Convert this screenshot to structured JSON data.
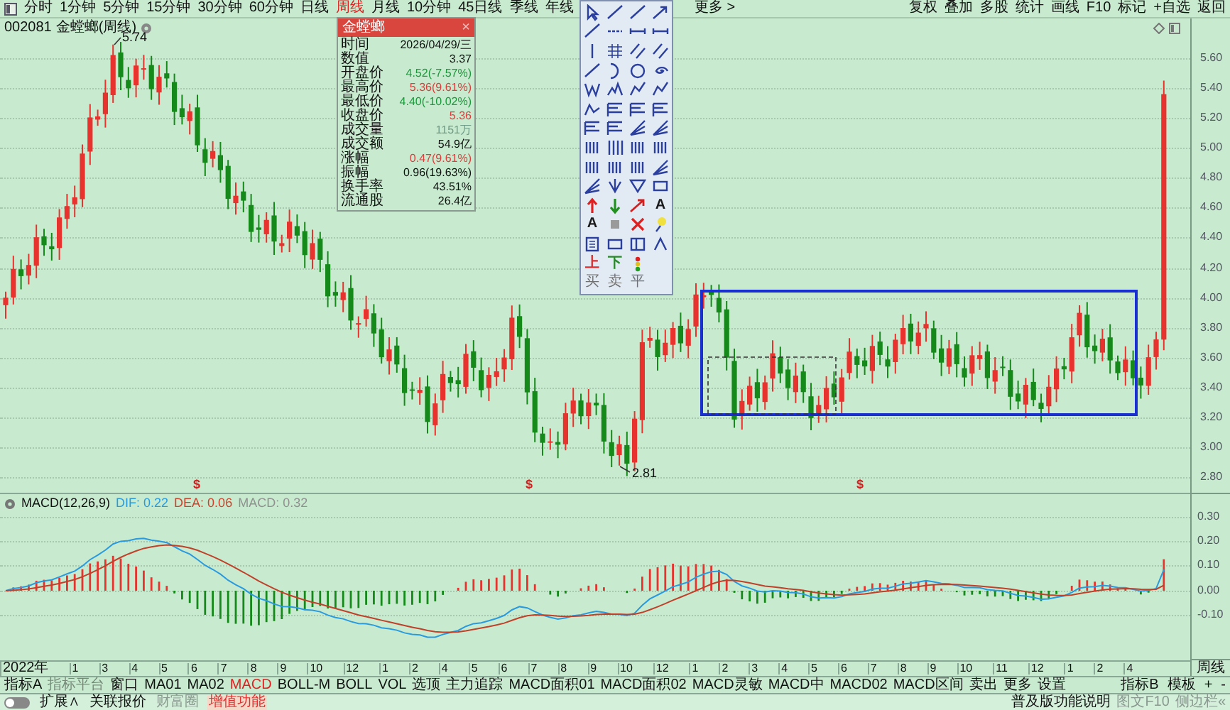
{
  "period_tabs": [
    {
      "label": "分时",
      "selected": false
    },
    {
      "label": "1分钟",
      "selected": false
    },
    {
      "label": "5分钟",
      "selected": false
    },
    {
      "label": "15分钟",
      "selected": false
    },
    {
      "label": "30分钟",
      "selected": false
    },
    {
      "label": "60分钟",
      "selected": false
    },
    {
      "label": "日线",
      "selected": false
    },
    {
      "label": "周线",
      "selected": true
    },
    {
      "label": "月线",
      "selected": false
    },
    {
      "label": "10分钟",
      "selected": false
    },
    {
      "label": "45日线",
      "selected": false
    },
    {
      "label": "季线",
      "selected": false
    },
    {
      "label": "年线",
      "selected": false
    }
  ],
  "more_button": "更多 >",
  "top_actions": [
    "复权",
    "叠加",
    "多股",
    "统计",
    "画线",
    "F10",
    "标记",
    "+自选",
    "返回"
  ],
  "chart_header": {
    "code": "002081",
    "name": "金螳螂(周线)"
  },
  "high_label": "5.74",
  "low_label": "2.81",
  "signal_marks": [
    "$",
    "$",
    "$"
  ],
  "info_panel": {
    "title": "金螳螂",
    "close": "×",
    "rows": [
      {
        "label": "时间",
        "value": "2026/04/29/三",
        "color": "#111111"
      },
      {
        "label": "数值",
        "value": "3.37",
        "color": "#111111"
      },
      {
        "label": "开盘价",
        "value": "4.52(-7.57%)",
        "color": "#1a9a3a"
      },
      {
        "label": "最高价",
        "value": "5.36(9.61%)",
        "color": "#e03c3c"
      },
      {
        "label": "最低价",
        "value": "4.40(-10.02%)",
        "color": "#1a9a3a"
      },
      {
        "label": "收盘价",
        "value": "5.36",
        "color": "#e03c3c"
      },
      {
        "label": "成交量",
        "value": "1151万",
        "color": "#6f9a86"
      },
      {
        "label": "成交额",
        "value": "54.9亿",
        "color": "#111111"
      },
      {
        "label": "涨幅",
        "value": "0.47(9.61%)",
        "color": "#e03c3c"
      },
      {
        "label": "振幅",
        "value": "0.96(19.63%)",
        "color": "#111111"
      },
      {
        "label": "换手率",
        "value": "43.51%",
        "color": "#111111"
      },
      {
        "label": "流通股",
        "value": "26.4亿",
        "color": "#111111"
      }
    ]
  },
  "palette_text_tools": [
    {
      "label": "A",
      "color": "#1a1a1a",
      "disabled": false
    },
    {
      "label": "A",
      "color": "#1a1a1a",
      "disabled": false
    },
    {
      "label": "上",
      "color": "#d83030",
      "disabled": false
    },
    {
      "label": "下",
      "color": "#2a8a2a",
      "disabled": false
    },
    {
      "label": "买",
      "color": "#707070",
      "disabled": true
    },
    {
      "label": "卖",
      "color": "#707070",
      "disabled": true
    },
    {
      "label": "平",
      "color": "#707070",
      "disabled": true
    }
  ],
  "macd_header": {
    "title": "MACD(12,26,9)",
    "values": [
      {
        "label": "DIF: 0.22",
        "color": "#2a9ae0"
      },
      {
        "label": "DEA: 0.06",
        "color": "#d0402a"
      },
      {
        "label": "MACD: 0.32",
        "color": "#909090"
      }
    ]
  },
  "price_axis": [
    "5.60",
    "5.40",
    "5.20",
    "5.00",
    "4.80",
    "4.60",
    "4.40",
    "4.20",
    "4.00",
    "3.80",
    "3.60",
    "3.40",
    "3.20",
    "3.00",
    "2.80"
  ],
  "macd_axis": [
    "0.30",
    "0.20",
    "0.10",
    "0.00",
    "-0.10"
  ],
  "axis_period": "周线",
  "time_axis": [
    "2022年",
    "1",
    "3",
    "4",
    "5",
    "6",
    "7",
    "8",
    "9",
    "10",
    "12",
    "1",
    "2",
    "4",
    "5",
    "6",
    "7",
    "8",
    "9",
    "10",
    "12",
    "1",
    "2",
    "3",
    "4",
    "5",
    "6",
    "7",
    "8",
    "9",
    "10",
    "11",
    "12",
    "1",
    "2",
    "4"
  ],
  "indicator_tabs": [
    {
      "label": "指标A",
      "selected": false,
      "disabled": false
    },
    {
      "label": "指标平台",
      "selected": false,
      "disabled": true
    },
    {
      "label": "窗口",
      "selected": false,
      "disabled": false
    },
    {
      "label": "MA01",
      "selected": false,
      "disabled": false
    },
    {
      "label": "MA02",
      "selected": false,
      "disabled": false
    },
    {
      "label": "MACD",
      "selected": true,
      "disabled": false
    },
    {
      "label": "BOLL-M",
      "selected": false,
      "disabled": false
    },
    {
      "label": "BOLL",
      "selected": false,
      "disabled": false
    },
    {
      "label": "VOL",
      "selected": false,
      "disabled": false
    },
    {
      "label": "选顶",
      "selected": false,
      "disabled": false
    },
    {
      "label": "主力追踪",
      "selected": false,
      "disabled": false
    },
    {
      "label": "MACD面积01",
      "selected": false,
      "disabled": false
    },
    {
      "label": "MACD面积02",
      "selected": false,
      "disabled": false
    },
    {
      "label": "MACD灵敏",
      "selected": false,
      "disabled": false
    },
    {
      "label": "MACD中",
      "selected": false,
      "disabled": false
    },
    {
      "label": "MACD02",
      "selected": false,
      "disabled": false
    },
    {
      "label": "MACD区间",
      "selected": false,
      "disabled": false
    },
    {
      "label": "卖出",
      "selected": false,
      "disabled": false
    },
    {
      "label": "更多",
      "selected": false,
      "disabled": false
    },
    {
      "label": "设置",
      "selected": false,
      "disabled": false
    }
  ],
  "indicator_right": [
    "指标B",
    "模板",
    "+",
    "-"
  ],
  "bottom_bar": {
    "toggle_on": false,
    "left": [
      {
        "label": "扩展∧",
        "color": "#111111",
        "highlighted": false
      },
      {
        "label": "关联报价",
        "color": "#111111",
        "highlighted": false
      },
      {
        "label": "财富圈",
        "color": "#8a9a90",
        "highlighted": false
      },
      {
        "label": "增值功能",
        "color": "#e03030",
        "highlighted": true
      }
    ],
    "right": [
      {
        "label": "普及版功能说明",
        "color": "#111111"
      },
      {
        "label": "图文F10",
        "color": "#8a9a90"
      },
      {
        "label": "侧边栏«",
        "color": "#8a9a90"
      }
    ]
  }
}
